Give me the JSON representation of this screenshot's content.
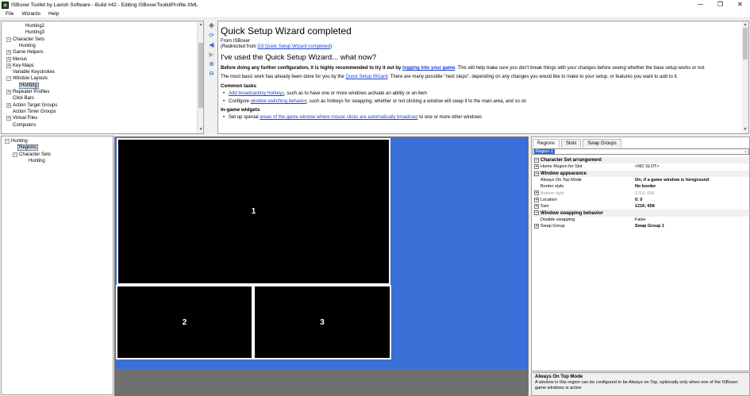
{
  "window": {
    "title": "ISBoxer Toolkit by Lavish Software - Build #42 - Editing ISBoxerToolkitProfile.XML",
    "minimize": "—",
    "restore": "❐",
    "close": "✕"
  },
  "menu": [
    "File",
    "Wizards",
    "Help"
  ],
  "tree_top": {
    "items": [
      {
        "label": "Hunting2",
        "indent": 3,
        "exp": ""
      },
      {
        "label": "Hunting3",
        "indent": 3,
        "exp": ""
      },
      {
        "label": "Character Sets",
        "indent": 1,
        "exp": "−"
      },
      {
        "label": "Hunting",
        "indent": 2,
        "exp": ""
      },
      {
        "label": "Game Helpers",
        "indent": 1,
        "exp": "+"
      },
      {
        "label": "Menus",
        "indent": 1,
        "exp": "+"
      },
      {
        "label": "Key Maps",
        "indent": 1,
        "exp": "+"
      },
      {
        "label": "Variable Keystrokes",
        "indent": 1,
        "exp": ""
      },
      {
        "label": "Window Layouts",
        "indent": 1,
        "exp": "−"
      },
      {
        "label": "Hunting",
        "indent": 2,
        "exp": "",
        "selected": true
      },
      {
        "label": "Repeater Profiles",
        "indent": 1,
        "exp": "+"
      },
      {
        "label": "Click Bars",
        "indent": 1,
        "exp": ""
      },
      {
        "label": "Action Target Groups",
        "indent": 1,
        "exp": "+"
      },
      {
        "label": "Action Timer Groups",
        "indent": 1,
        "exp": ""
      },
      {
        "label": "Virtual Files",
        "indent": 1,
        "exp": "+"
      },
      {
        "label": "Computers",
        "indent": 1,
        "exp": ""
      }
    ]
  },
  "doc": {
    "title": "Quick Setup Wizard completed",
    "from": "From ISBoxer",
    "redirect_prefix": "(Redirected from ",
    "redirect_link": "D3:Quick Setup Wizard completed",
    "redirect_suffix": ")",
    "subtitle": "I've used the Quick Setup Wizard... what now?",
    "p1_bold": "Before doing any further configuration, it is highly recommended to try it out by ",
    "p1_link": "logging into your game",
    "p1_rest": ". This will help make sure you don't break things with your changes before seeing whether the base setup works or not.",
    "p2_text": "The most basic work has already been done for you by the ",
    "p2_link": "Quick Setup Wizard",
    "p2_rest": ". There are many possible \"next steps\", depending on any changes you would like to make to your setup, or features you want to add to it.",
    "h_common": "Common tasks",
    "li1_link": "Add broadcasting Hotkeys",
    "li1_rest": ", such as to have one or more windows activate an ability or an item",
    "li2_text": "Configure ",
    "li2_link": "window switching behavior",
    "li2_rest": ", such as hotkeys for swapping, whether or not clicking a window will swap it to the main area, and so on",
    "h_widgets": "In-game widgets",
    "li3_text": "Set up special ",
    "li3_link": "areas of the game window where mouse clicks are automatically broadcast",
    "li3_rest": " to one or more other windows"
  },
  "tree_bot": {
    "root": "Hunting",
    "regions": "Regions",
    "charsets": "Character Sets",
    "hunting": "Hunting"
  },
  "regions": [
    {
      "label": "1"
    },
    {
      "label": "2"
    },
    {
      "label": "3"
    }
  ],
  "props": {
    "tabs": [
      "Regions",
      "Slots",
      "Swap Groups"
    ],
    "selected_region": "Region 1",
    "rows": [
      {
        "type": "cat",
        "name": "Character Set arrangement",
        "exp": "−"
      },
      {
        "type": "prop",
        "name": "Home Region for Slot",
        "value": "<NO SLOT>",
        "exp": "+"
      },
      {
        "type": "cat",
        "name": "Window appearance",
        "exp": "−"
      },
      {
        "type": "prop",
        "name": "Always On Top Mode",
        "value": "On, if a game window is foreground",
        "bold": true
      },
      {
        "type": "prop",
        "name": "Border style",
        "value": "No border",
        "bold": true
      },
      {
        "type": "prop",
        "name": "Bottom right",
        "value": "1216; 658",
        "exp": "+",
        "disabled": true
      },
      {
        "type": "prop",
        "name": "Location",
        "value": "0; 0",
        "exp": "+",
        "bold": true
      },
      {
        "type": "prop",
        "name": "Size",
        "value": "1216; 658",
        "exp": "+",
        "bold": true
      },
      {
        "type": "cat",
        "name": "Window swapping behavior",
        "exp": "−"
      },
      {
        "type": "prop",
        "name": "Disable swapping",
        "value": "False"
      },
      {
        "type": "prop",
        "name": "Swap Group",
        "value": "Swap Group 1",
        "exp": "+",
        "bold": true
      }
    ]
  },
  "help": {
    "title": "Always On Top Mode",
    "desc": "A window in this region can be configured to be Always on Top, optionally only when one of the ISBoxer game windows is active"
  }
}
